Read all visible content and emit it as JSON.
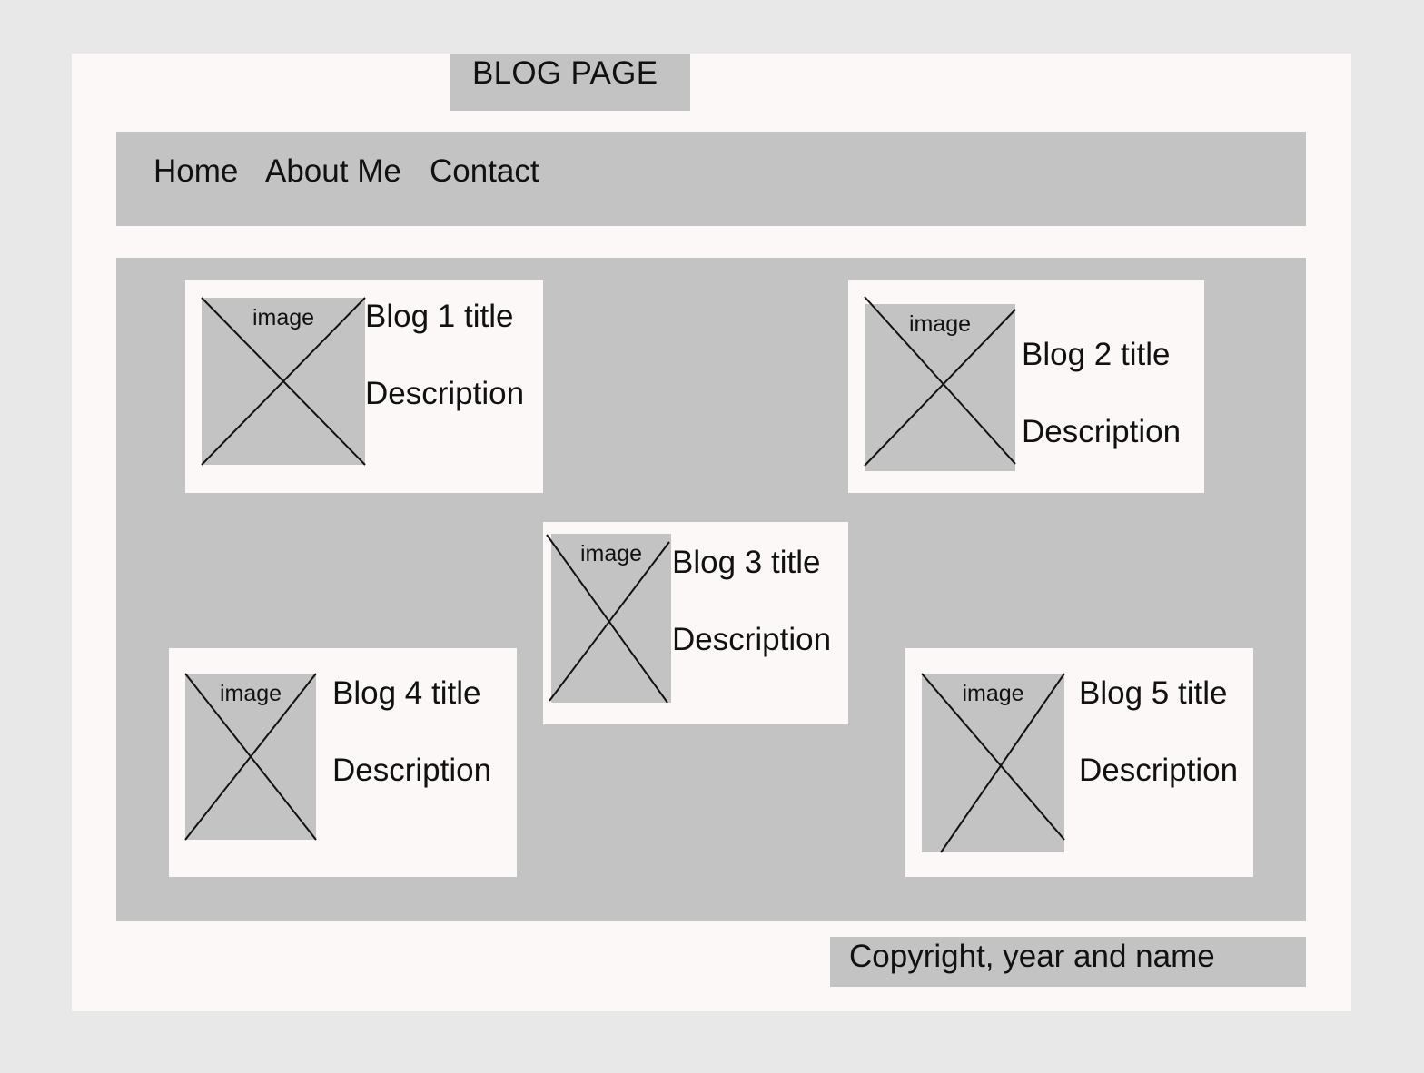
{
  "page": {
    "title": "BLOG PAGE"
  },
  "nav": {
    "items": [
      {
        "label": "Home"
      },
      {
        "label": "About Me"
      },
      {
        "label": "Contact"
      }
    ]
  },
  "blogs": [
    {
      "image_label": "image",
      "title": "Blog 1 title",
      "description": "Description"
    },
    {
      "image_label": "image",
      "title": "Blog 2 title",
      "description": "Description"
    },
    {
      "image_label": "image",
      "title": "Blog 3 title",
      "description": "Description"
    },
    {
      "image_label": "image",
      "title": "Blog 4 title",
      "description": "Description"
    },
    {
      "image_label": "image",
      "title": "Blog 5 title",
      "description": "Description"
    }
  ],
  "footer": {
    "text": "Copyright, year and name"
  }
}
